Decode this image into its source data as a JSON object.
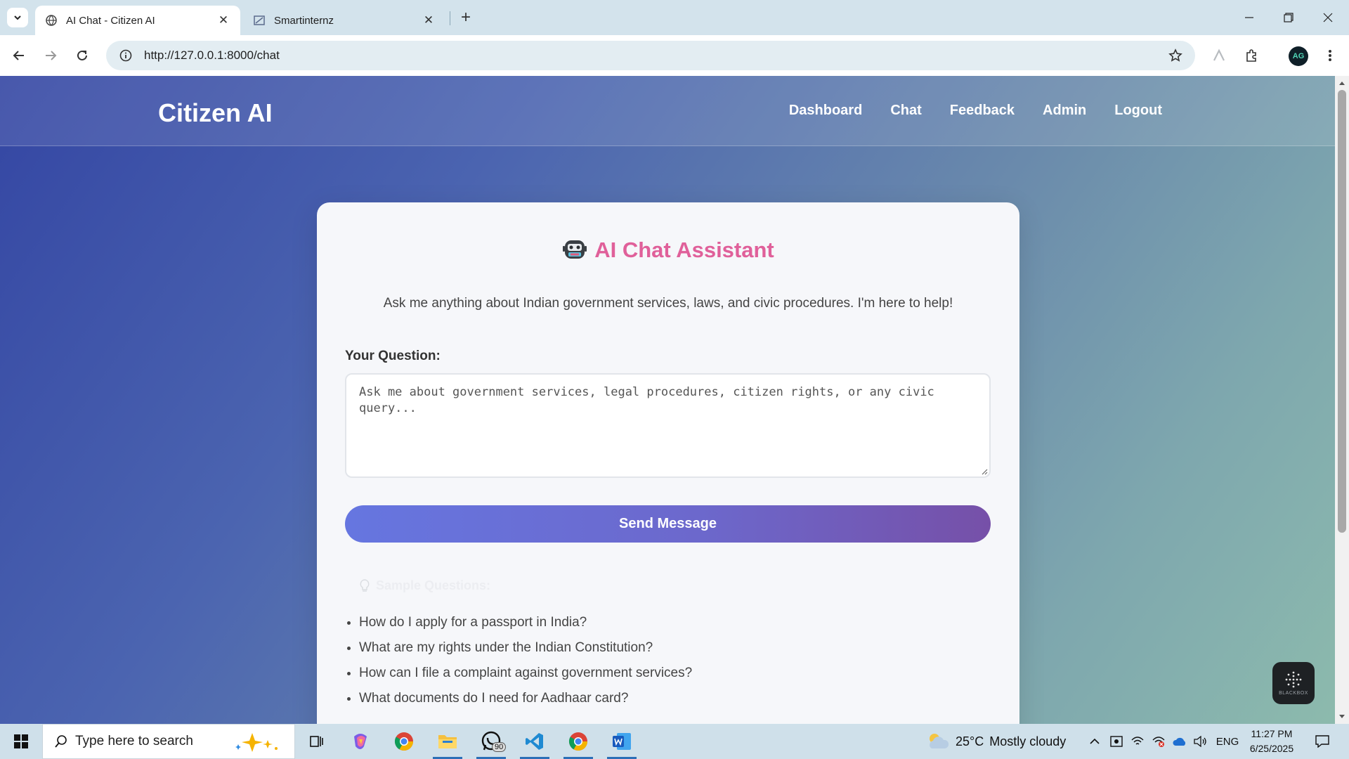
{
  "browser": {
    "tabs": [
      {
        "title": "AI Chat - Citizen AI",
        "active": true
      },
      {
        "title": "Smartinternz",
        "active": false
      }
    ],
    "url": "http://127.0.0.1:8000/chat",
    "profile_initials": "AG"
  },
  "site": {
    "brand": "Citizen AI",
    "nav": [
      "Dashboard",
      "Chat",
      "Feedback",
      "Admin",
      "Logout"
    ]
  },
  "chat": {
    "title": "AI Chat Assistant",
    "subtitle": "Ask me anything about Indian government services, laws, and civic procedures. I'm here to help!",
    "question_label": "Your Question:",
    "question_placeholder": "Ask me about government services, legal procedures, citizen rights, or any civic query...",
    "send_label": "Send Message",
    "samples_heading": "Sample Questions:",
    "samples": [
      "How do I apply for a passport in India?",
      "What are my rights under the Indian Constitution?",
      "How can I file a complaint against government services?",
      "What documents do I need for Aadhaar card?"
    ]
  },
  "overlay": {
    "blackbox_label": "BLACKBOX"
  },
  "taskbar": {
    "search_placeholder": "Type here to search",
    "whatsapp_badge": "90",
    "weather_temp": "25°C",
    "weather_desc": "Mostly cloudy",
    "language": "ENG",
    "time": "11:27 PM",
    "date": "6/25/2025"
  },
  "colors": {
    "accent_title": "#e0609a",
    "button_gradient_start": "#6676e0",
    "button_gradient_end": "#7650a8",
    "header_gradient_start": "#3446a3",
    "header_gradient_end": "#8dbbad"
  }
}
